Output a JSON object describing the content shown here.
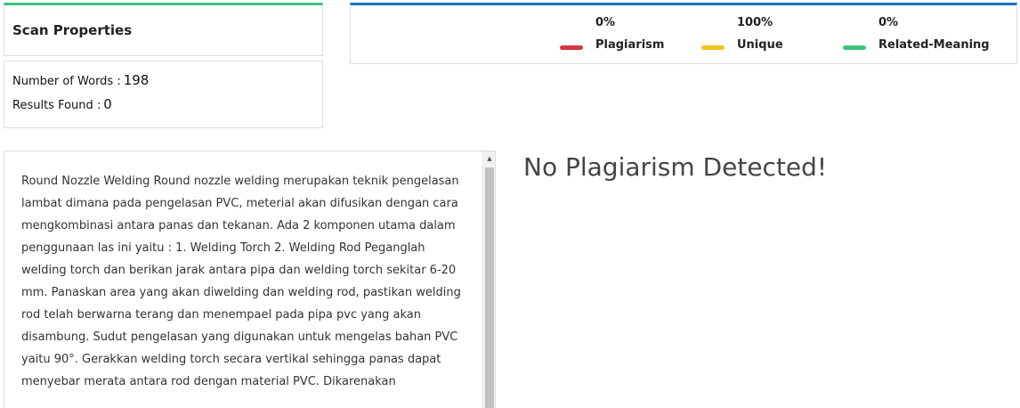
{
  "scan_properties": {
    "title": "Scan Properties",
    "words_label": "Number of Words :",
    "words_value": "198",
    "results_label": "Results Found :",
    "results_value": "0"
  },
  "summary": {
    "plagiarism": {
      "percent": "0%",
      "label": "Plagiarism",
      "color": "#d9363e"
    },
    "unique": {
      "percent": "100%",
      "label": "Unique",
      "color": "#f2c21b"
    },
    "related": {
      "percent": "0%",
      "label": "Related-Meaning",
      "color": "#3cc57c"
    }
  },
  "document_text": "Round Nozzle Welding Round nozzle welding merupakan teknik pengelasan lambat dimana pada pengelasan PVC, meterial akan difusikan dengan cara mengkombinasi antara panas dan tekanan. Ada 2 komponen utama dalam penggunaan las ini yaitu : 1. Welding Torch 2. Welding Rod Peganglah welding torch dan berikan jarak antara pipa dan welding torch sekitar 6-20 mm. Panaskan area yang akan diwelding dan welding rod, pastikan welding rod telah berwarna terang dan menempael pada pipa pvc yang akan disambung. Sudut pengelasan yang digunakan untuk mengelas bahan PVC yaitu 90°. Gerakkan welding torch secara vertikal sehingga panas dapat menyebar merata antara rod dengan material PVC. Dikarenakan",
  "result_message": "No Plagiarism Detected!",
  "icons": {
    "scroll_up": "scroll-up-arrow-icon"
  }
}
